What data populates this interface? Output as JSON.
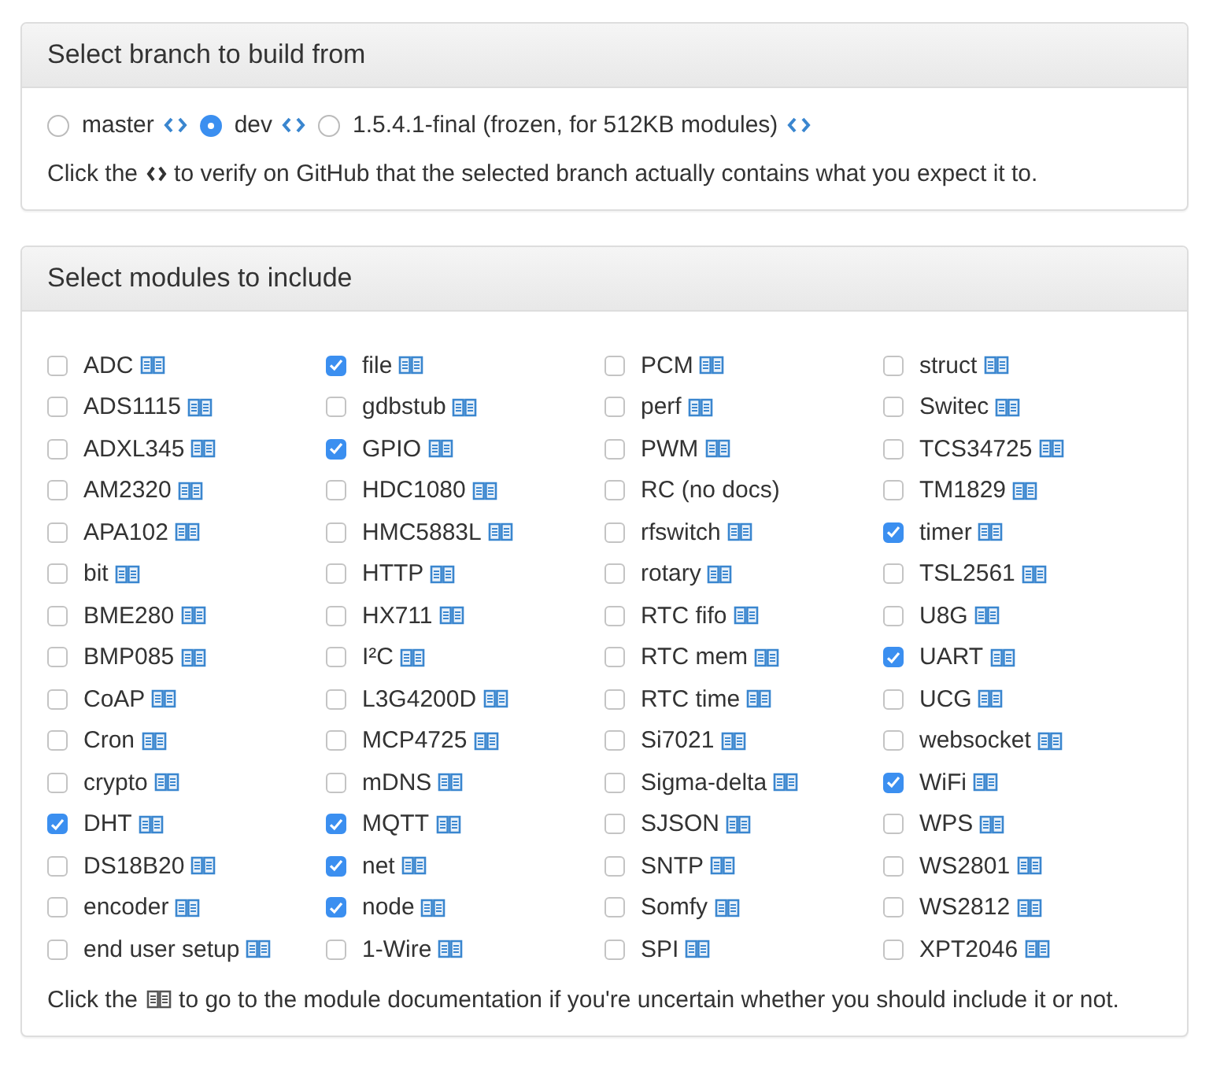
{
  "branch_panel": {
    "title": "Select branch to build from",
    "branches": [
      {
        "label": "master",
        "selected": false,
        "code_link": true
      },
      {
        "label": "dev",
        "selected": true,
        "code_link": true
      },
      {
        "label": "1.5.4.1-final (frozen, for 512KB modules)",
        "selected": false,
        "code_link": true
      }
    ],
    "note": {
      "before": "Click the",
      "after": "to verify on GitHub that the selected branch actually contains what you expect it to."
    }
  },
  "modules_panel": {
    "title": "Select modules to include",
    "columns": [
      [
        {
          "name": "ADC",
          "checked": false,
          "docs": true
        },
        {
          "name": "ADS1115",
          "checked": false,
          "docs": true
        },
        {
          "name": "ADXL345",
          "checked": false,
          "docs": true
        },
        {
          "name": "AM2320",
          "checked": false,
          "docs": true
        },
        {
          "name": "APA102",
          "checked": false,
          "docs": true
        },
        {
          "name": "bit",
          "checked": false,
          "docs": true
        },
        {
          "name": "BME280",
          "checked": false,
          "docs": true
        },
        {
          "name": "BMP085",
          "checked": false,
          "docs": true
        },
        {
          "name": "CoAP",
          "checked": false,
          "docs": true
        },
        {
          "name": "Cron",
          "checked": false,
          "docs": true
        },
        {
          "name": "crypto",
          "checked": false,
          "docs": true
        },
        {
          "name": "DHT",
          "checked": true,
          "docs": true
        },
        {
          "name": "DS18B20",
          "checked": false,
          "docs": true
        },
        {
          "name": "encoder",
          "checked": false,
          "docs": true
        },
        {
          "name": "end user setup",
          "checked": false,
          "docs": true
        }
      ],
      [
        {
          "name": "file",
          "checked": true,
          "docs": true
        },
        {
          "name": "gdbstub",
          "checked": false,
          "docs": true
        },
        {
          "name": "GPIO",
          "checked": true,
          "docs": true
        },
        {
          "name": "HDC1080",
          "checked": false,
          "docs": true
        },
        {
          "name": "HMC5883L",
          "checked": false,
          "docs": true
        },
        {
          "name": "HTTP",
          "checked": false,
          "docs": true
        },
        {
          "name": "HX711",
          "checked": false,
          "docs": true
        },
        {
          "name": "I²C",
          "checked": false,
          "docs": true
        },
        {
          "name": "L3G4200D",
          "checked": false,
          "docs": true
        },
        {
          "name": "MCP4725",
          "checked": false,
          "docs": true
        },
        {
          "name": "mDNS",
          "checked": false,
          "docs": true
        },
        {
          "name": "MQTT",
          "checked": true,
          "docs": true
        },
        {
          "name": "net",
          "checked": true,
          "docs": true
        },
        {
          "name": "node",
          "checked": true,
          "docs": true
        },
        {
          "name": "1-Wire",
          "checked": false,
          "docs": true
        }
      ],
      [
        {
          "name": "PCM",
          "checked": false,
          "docs": true
        },
        {
          "name": "perf",
          "checked": false,
          "docs": true
        },
        {
          "name": "PWM",
          "checked": false,
          "docs": true
        },
        {
          "name": "RC (no docs)",
          "checked": false,
          "docs": false
        },
        {
          "name": "rfswitch",
          "checked": false,
          "docs": true
        },
        {
          "name": "rotary",
          "checked": false,
          "docs": true
        },
        {
          "name": "RTC fifo",
          "checked": false,
          "docs": true
        },
        {
          "name": "RTC mem",
          "checked": false,
          "docs": true
        },
        {
          "name": "RTC time",
          "checked": false,
          "docs": true
        },
        {
          "name": "Si7021",
          "checked": false,
          "docs": true
        },
        {
          "name": "Sigma-delta",
          "checked": false,
          "docs": true
        },
        {
          "name": "SJSON",
          "checked": false,
          "docs": true
        },
        {
          "name": "SNTP",
          "checked": false,
          "docs": true
        },
        {
          "name": "Somfy",
          "checked": false,
          "docs": true
        },
        {
          "name": "SPI",
          "checked": false,
          "docs": true
        }
      ],
      [
        {
          "name": "struct",
          "checked": false,
          "docs": true
        },
        {
          "name": "Switec",
          "checked": false,
          "docs": true
        },
        {
          "name": "TCS34725",
          "checked": false,
          "docs": true
        },
        {
          "name": "TM1829",
          "checked": false,
          "docs": true
        },
        {
          "name": "timer",
          "checked": true,
          "docs": true
        },
        {
          "name": "TSL2561",
          "checked": false,
          "docs": true
        },
        {
          "name": "U8G",
          "checked": false,
          "docs": true
        },
        {
          "name": "UART",
          "checked": true,
          "docs": true
        },
        {
          "name": "UCG",
          "checked": false,
          "docs": true
        },
        {
          "name": "websocket",
          "checked": false,
          "docs": true
        },
        {
          "name": "WiFi",
          "checked": true,
          "docs": true
        },
        {
          "name": "WPS",
          "checked": false,
          "docs": true
        },
        {
          "name": "WS2801",
          "checked": false,
          "docs": true
        },
        {
          "name": "WS2812",
          "checked": false,
          "docs": true
        },
        {
          "name": "XPT2046",
          "checked": false,
          "docs": true
        }
      ]
    ],
    "note": {
      "before": "Click the",
      "after": "to go to the module documentation if you're uncertain whether you should include it or not."
    }
  }
}
